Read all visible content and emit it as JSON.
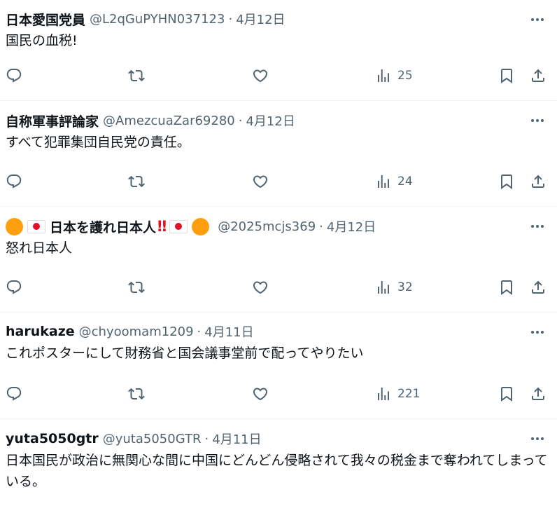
{
  "tweets": [
    {
      "name": "日本愛国党員",
      "handle": "@L2qGuPYHN037123",
      "sep": "·",
      "date": "4月12日",
      "text": "国民の血税!",
      "views": "25"
    },
    {
      "name": "自称軍事評論家",
      "handle": "@AmezcuaZar69280",
      "sep": "·",
      "date": "4月12日",
      "text": "すべて犯罪集団自民党の責任。",
      "views": "24"
    },
    {
      "name_prefix_icons": [
        "orange-circle-emoji",
        "japan-flag-emoji"
      ],
      "name": "日本を護れ日本人",
      "name_bang": "‼",
      "name_suffix_icons": [
        "japan-flag-emoji",
        "orange-circle-emoji"
      ],
      "handle": "@2025mcjs369",
      "sep": "·",
      "date": "4月12日",
      "text": "怒れ日本人",
      "views": "32"
    },
    {
      "name": "harukaze",
      "handle": "@chyoomam1209",
      "sep": "·",
      "date": "4月11日",
      "text": "これポスターにして財務省と国会議事堂前で配ってやりたい",
      "views": "221"
    },
    {
      "name": "yuta5050gtr",
      "handle": "@yuta5050GTR",
      "sep": "·",
      "date": "4月11日",
      "text": "日本国民が政治に無関心な間に中国にどんどん侵略されて我々の税金まで奪われてしまっている。"
    }
  ],
  "colors": {
    "text": "#0f1419",
    "secondary": "#536471",
    "divider": "#eff3f4"
  }
}
